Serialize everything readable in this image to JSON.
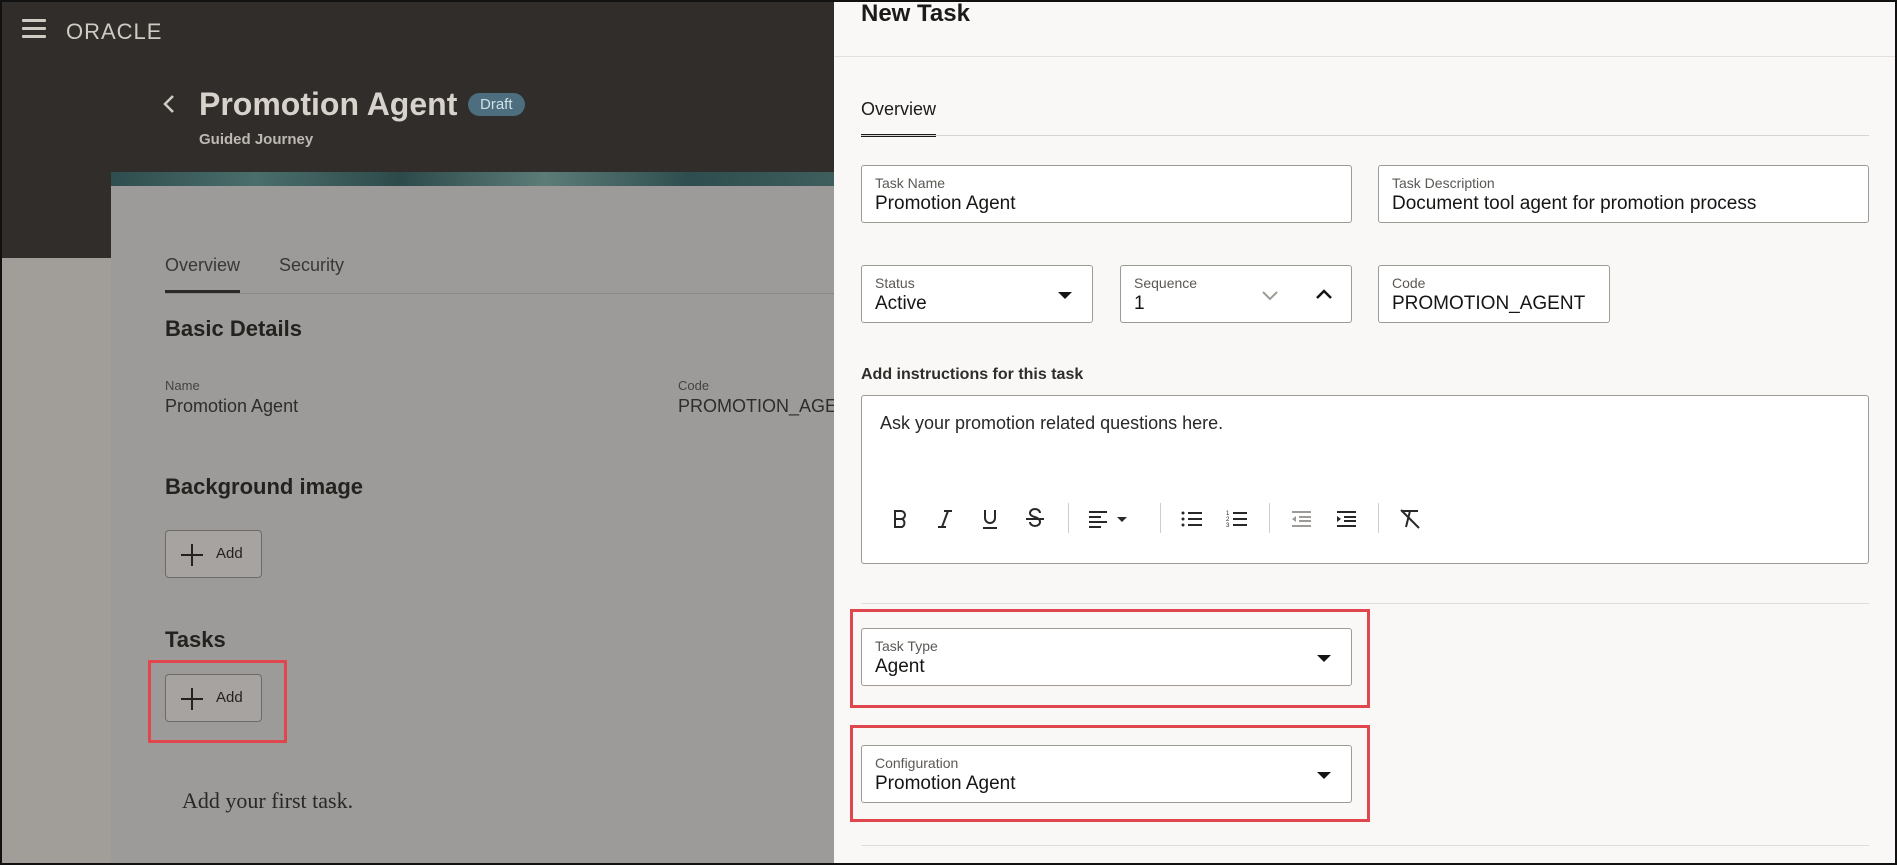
{
  "header": {
    "logo": "ORACLE",
    "page_title": "Promotion Agent",
    "status_badge": "Draft",
    "subtitle": "Guided Journey"
  },
  "background_page": {
    "tabs": [
      {
        "label": "Overview",
        "active": true
      },
      {
        "label": "Security",
        "active": false
      }
    ],
    "basic_details": {
      "heading": "Basic Details",
      "name_label": "Name",
      "name_value": "Promotion Agent",
      "code_label": "Code",
      "code_value": "PROMOTION_AGENT"
    },
    "background_image": {
      "heading": "Background image",
      "add_label": "Add"
    },
    "tasks": {
      "heading": "Tasks",
      "add_label": "Add",
      "empty_text": "Add your first task."
    }
  },
  "drawer": {
    "title": "New Task",
    "tab": "Overview",
    "task_name": {
      "label": "Task Name",
      "value": "Promotion Agent"
    },
    "task_description": {
      "label": "Task Description",
      "value": "Document tool agent for promotion process"
    },
    "status": {
      "label": "Status",
      "value": "Active"
    },
    "sequence": {
      "label": "Sequence",
      "value": "1"
    },
    "code": {
      "label": "Code",
      "value": "PROMOTION_AGENT"
    },
    "instructions": {
      "label": "Add instructions for this task",
      "value": "Ask your promotion related questions here.",
      "toolbar": [
        "bold",
        "italic",
        "underline",
        "strikethrough",
        "align",
        "bulleted-list",
        "numbered-list",
        "outdent",
        "indent",
        "clear-formatting"
      ]
    },
    "task_type": {
      "label": "Task Type",
      "value": "Agent"
    },
    "configuration": {
      "label": "Configuration",
      "value": "Promotion Agent"
    }
  },
  "colors": {
    "highlight": "#e0474c",
    "header_bg": "#312d2a",
    "drawer_bg": "#f9f8f6",
    "badge_bg": "#4c6e7e"
  }
}
